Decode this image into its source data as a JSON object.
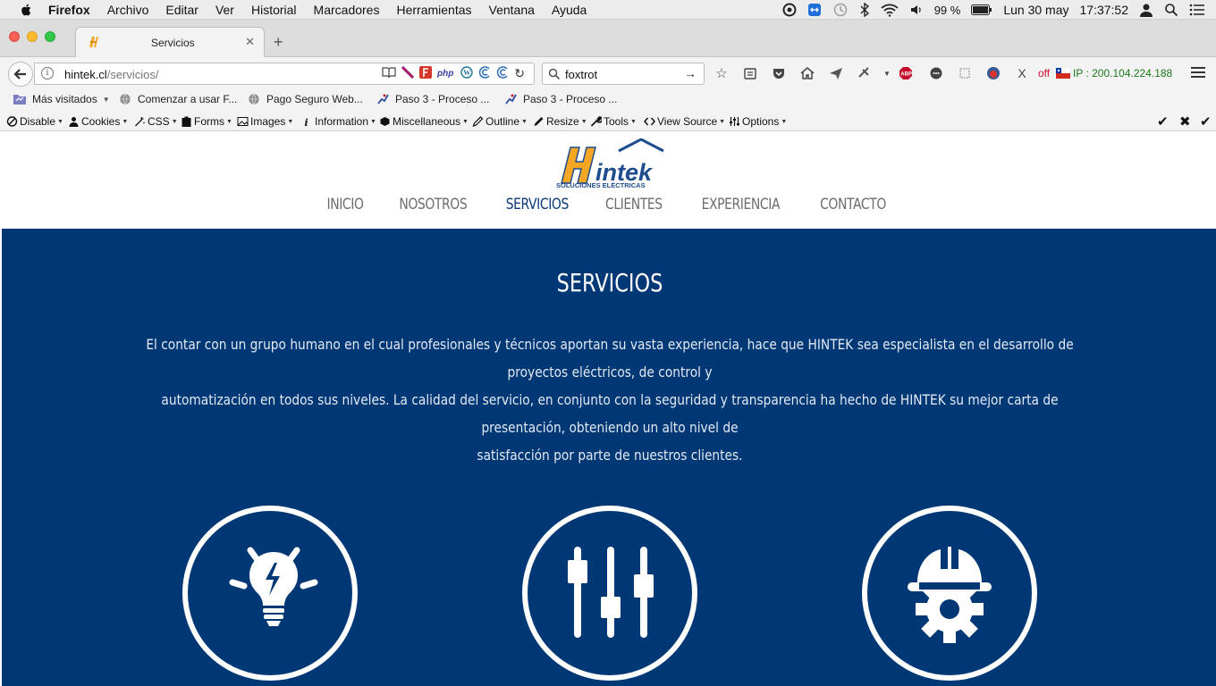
{
  "menubar": {
    "items": [
      "Firefox",
      "Archivo",
      "Editar",
      "Ver",
      "Historial",
      "Marcadores",
      "Herramientas",
      "Ventana",
      "Ayuda"
    ],
    "battery": "99 %",
    "date": "Lun 30 may",
    "time": "17:37:52"
  },
  "tab": {
    "title": "Servicios"
  },
  "urlbar": {
    "host": "hintek.cl",
    "path": "/servicios/"
  },
  "search": {
    "query": "foxtrot"
  },
  "status": {
    "off": "off",
    "ip": "IP : 200.104.224.188"
  },
  "bookmarks": [
    "Más visitados",
    "Comenzar a usar F...",
    "Pago Seguro Web...",
    "Paso 3 - Proceso ...",
    "Paso 3 - Proceso ..."
  ],
  "webdev": [
    "Disable",
    "Cookies",
    "CSS",
    "Forms",
    "Images",
    "Information",
    "Miscellaneous",
    "Outline",
    "Resize",
    "Tools",
    "View Source",
    "Options"
  ],
  "site": {
    "logo_text": "intek",
    "logo_letter": "H",
    "logo_sub": "SOLUCIONES ELÉCTRICAS",
    "nav": [
      "INICIO",
      "NOSOTROS",
      "SERVICIOS",
      "CLIENTES",
      "EXPERIENCIA",
      "CONTACTO"
    ],
    "active_nav": "SERVICIOS",
    "section_title": "SERVICIOS",
    "lines": [
      "El contar con un grupo humano en el cual profesionales y técnicos aportan su vasta experiencia, hace que HINTEK sea especialista en el desarrollo de proyectos eléctricos, de control y",
      "automatización en todos sus niveles. La calidad del servicio, en conjunto con la seguridad y transparencia ha hecho de HINTEK su mejor carta de presentación, obteniendo un alto nivel de",
      "satisfacción por parte de nuestros clientes."
    ],
    "services_icons": [
      "lightbulb-icon",
      "sliders-icon",
      "hardhat-gear-icon"
    ]
  },
  "colors": {
    "hero_bg": "#003876",
    "nav_active": "#0d3a78",
    "logo_orange": "#f5a623",
    "logo_blue": "#1d4c8f"
  }
}
